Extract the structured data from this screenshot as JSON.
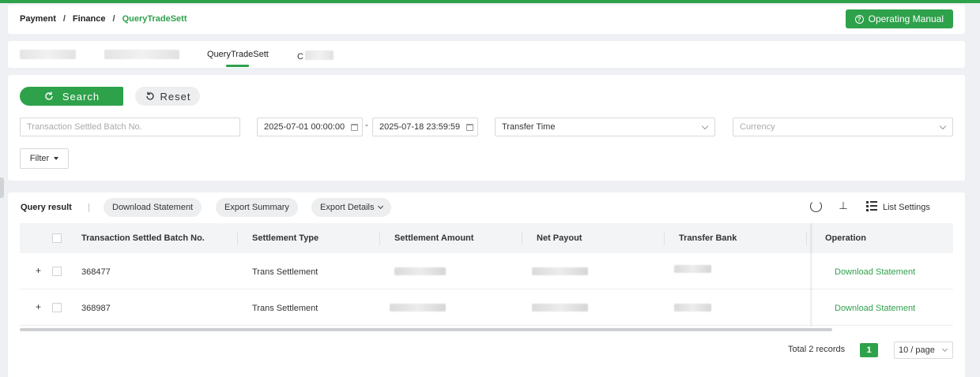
{
  "breadcrumb": {
    "items": [
      "Payment",
      "Finance"
    ],
    "current": "QueryTradeSett",
    "separator": "/"
  },
  "header": {
    "manual_label": "Operating Manual",
    "manual_icon": "question-circle-icon"
  },
  "tabs": {
    "active_label": "QueryTradeSett",
    "partial_label": "C"
  },
  "filters": {
    "search_label": "Search",
    "reset_label": "Reset",
    "batch_placeholder": "Transaction Settled Batch No.",
    "date_start": "2025-07-01 00:00:00",
    "date_end": "2025-07-18 23:59:59",
    "date_separator": "-",
    "time_type": "Transfer Time",
    "currency_placeholder": "Currency",
    "filter_label": "Filter"
  },
  "results": {
    "title": "Query result",
    "separator": "|",
    "download_statement": "Download Statement",
    "export_summary": "Export Summary",
    "export_details": "Export Details",
    "list_settings": "List Settings"
  },
  "table": {
    "columns": [
      "Transaction Settled Batch No.",
      "Settlement Type",
      "Settlement Amount",
      "Net Payout",
      "Transfer Bank",
      "Operation"
    ],
    "rows": [
      {
        "expand": "+",
        "batch_no": "368477",
        "type": "Trans Settlement",
        "operation": "Download Statement"
      },
      {
        "expand": "+",
        "batch_no": "368987",
        "type": "Trans Settlement",
        "operation": "Download Statement"
      }
    ]
  },
  "pagination": {
    "total": "Total 2 records",
    "current_page": "1",
    "page_size": "10 / page"
  },
  "colors": {
    "accent": "#2ea14b",
    "background": "#eef0f3"
  }
}
